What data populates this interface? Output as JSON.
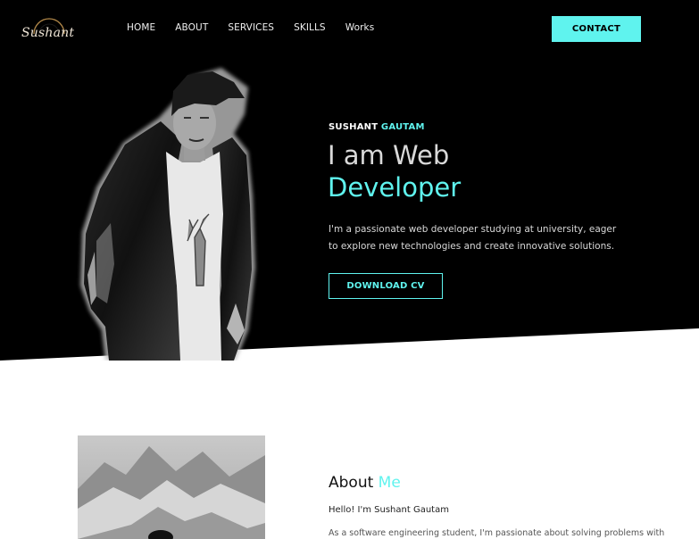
{
  "brand": {
    "logo_text": "Sushant"
  },
  "nav": {
    "items": [
      {
        "label": "HOME"
      },
      {
        "label": "ABOUT"
      },
      {
        "label": "SERVICES"
      },
      {
        "label": "SKILLS"
      },
      {
        "label": "Works"
      }
    ]
  },
  "header": {
    "contact_label": "CONTACT"
  },
  "hero": {
    "kicker_first": "SUSHANT",
    "kicker_last": "GAUTAM",
    "headline_line1": "I am Web",
    "headline_line2": "Developer",
    "intro": "I'm a passionate web developer studying at university, eager to explore new technologies and create innovative solutions.",
    "download_label": "DOWNLOAD CV"
  },
  "about": {
    "title_first": "About",
    "title_accent": "Me",
    "hello": "Hello! I'm Sushant Gautam",
    "body": "As a software engineering student, I'm passionate about solving problems with"
  },
  "colors": {
    "accent": "#5ff3ee",
    "hero_background": "#000000",
    "page_background": "#ffffff"
  },
  "icons": {
    "logo": "sun-arc-logo-icon"
  }
}
